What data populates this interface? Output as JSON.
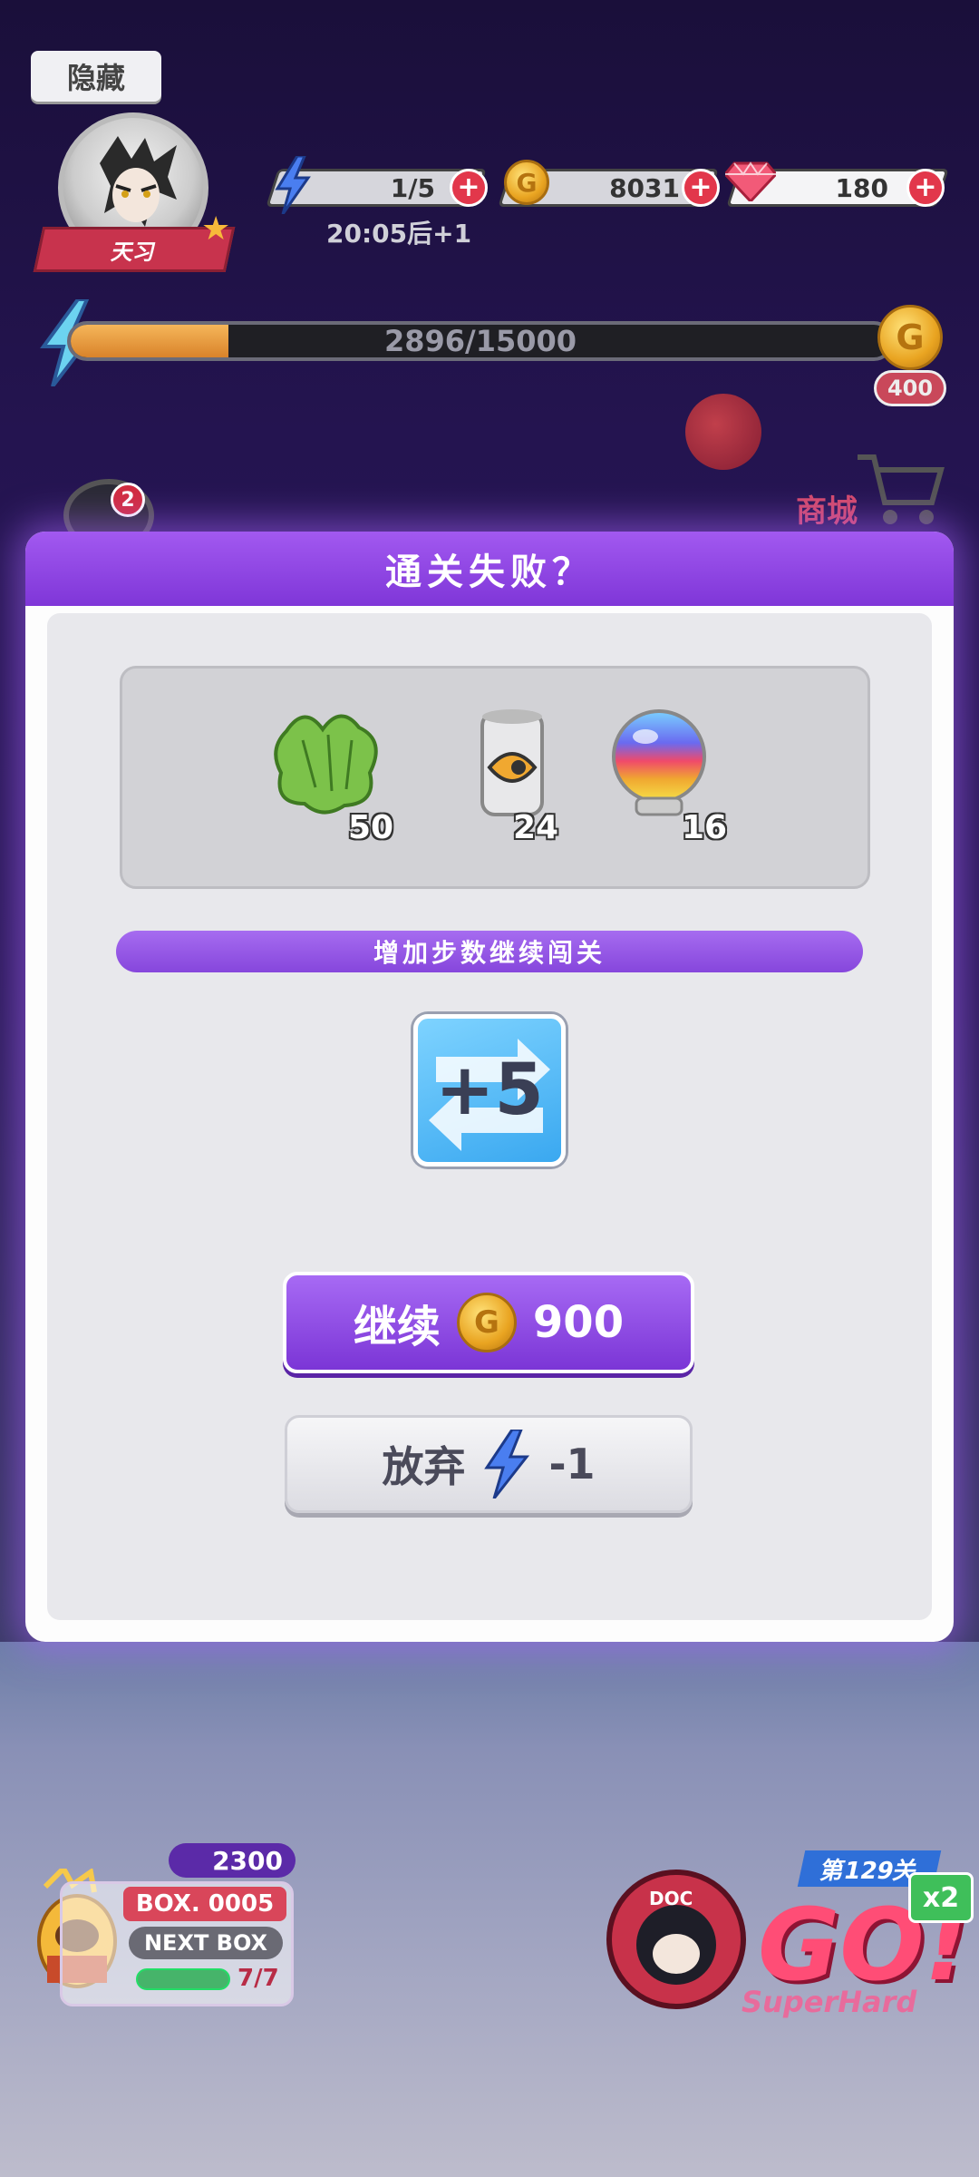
{
  "hud": {
    "hide_label": "隐藏",
    "player_name": "天习",
    "energy": "1/5",
    "coins": "8031",
    "gems": "180",
    "energy_timer": "20:05后+1",
    "exp_progress_text": "2896/15000",
    "exp_progress_fraction": 0.193,
    "reward_amount": "400",
    "shop_label": "商城",
    "notification_count": "2"
  },
  "dialog": {
    "title": "通关失败？",
    "rewards": [
      {
        "icon": "leaf-bundle-icon",
        "count": "50"
      },
      {
        "icon": "drink-can-icon",
        "count": "24"
      },
      {
        "icon": "rainbow-orb-icon",
        "count": "16"
      }
    ],
    "section_title": "增加步数继续闯关",
    "bonus_moves": "+5",
    "continue_label": "继续",
    "continue_cost": "900",
    "abandon_label": "放弃",
    "abandon_cost": "-1"
  },
  "bottom": {
    "gem_count": "2300",
    "box_title": "BOX. 0005",
    "next_box_label": "NEXT BOX",
    "box_ratio": "7/7",
    "level_label": "第129关",
    "go_label": "GO!",
    "multiplier": "x2",
    "difficulty": "SuperHard",
    "char_label": "DOC"
  },
  "colors": {
    "accent_purple": "#8646dc",
    "danger_red": "#e2374b",
    "coin_gold": "#e9a421"
  }
}
